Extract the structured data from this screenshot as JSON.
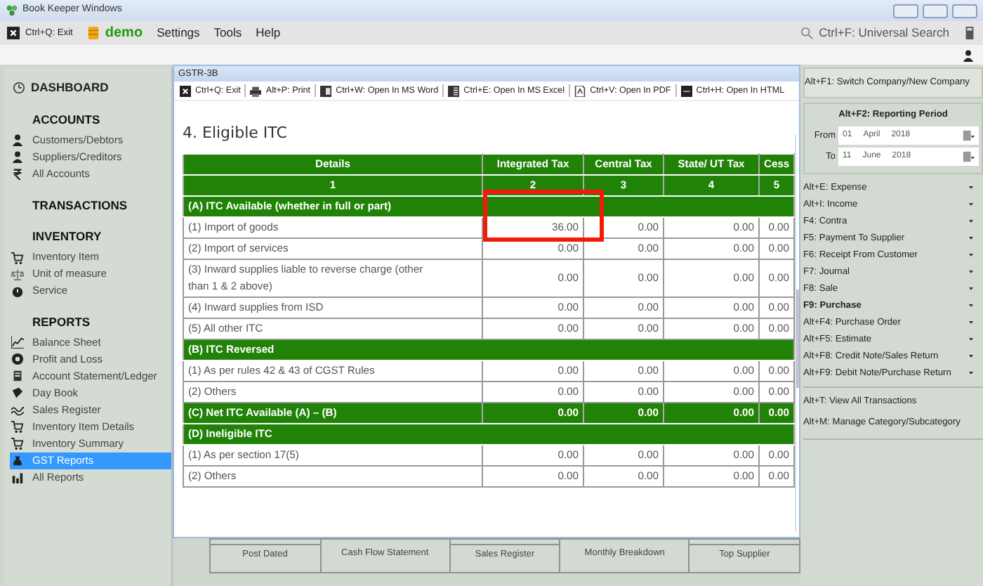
{
  "window": {
    "title": "Book Keeper Windows"
  },
  "menu_bar": {
    "exit": "Ctrl+Q: Exit",
    "company": "demo",
    "items": [
      "Settings",
      "Tools",
      "Help"
    ],
    "search": "Ctrl+F: Universal Search"
  },
  "sidebar": {
    "dashboard": "DASHBOARD",
    "sections": [
      {
        "title": "ACCOUNTS",
        "items": [
          {
            "label": "Customers/Debtors",
            "selected": false
          },
          {
            "label": "Suppliers/Creditors",
            "selected": false
          },
          {
            "label": "All Accounts",
            "selected": false
          }
        ]
      },
      {
        "title": "TRANSACTIONS"
      },
      {
        "title": "INVENTORY",
        "items": [
          {
            "label": "Inventory Item",
            "selected": false
          },
          {
            "label": "Unit of measure",
            "selected": false
          },
          {
            "label": "Service",
            "selected": false
          }
        ]
      },
      {
        "title": "REPORTS",
        "items": [
          {
            "label": "Balance Sheet",
            "selected": false
          },
          {
            "label": "Profit and Loss",
            "selected": false
          },
          {
            "label": "Account Statement/Ledger",
            "selected": false
          },
          {
            "label": "Day Book",
            "selected": false
          },
          {
            "label": "Sales Register",
            "selected": false
          },
          {
            "label": "Inventory Item Details",
            "selected": false
          },
          {
            "label": "Inventory Summary",
            "selected": false
          },
          {
            "label": "GST Reports",
            "selected": true
          },
          {
            "label": "All Reports",
            "selected": false
          }
        ]
      }
    ]
  },
  "dialog": {
    "title": "GSTR-3B",
    "toolbar": [
      {
        "kind": "exit",
        "label": "Ctrl+Q: Exit"
      },
      {
        "kind": "print",
        "label": "Alt+P: Print"
      },
      {
        "kind": "word",
        "label": "Ctrl+W: Open In MS Word"
      },
      {
        "kind": "excel",
        "label": "Ctrl+E: Open In MS Excel"
      },
      {
        "kind": "pdf",
        "label": "Ctrl+V: Open In PDF"
      },
      {
        "kind": "html",
        "label": "Ctrl+H: Open In HTML"
      }
    ],
    "heading": "4. Eligible ITC",
    "table": {
      "columns": [
        "Details",
        "Integrated Tax",
        "Central Tax",
        "State/ UT Tax",
        "Cess"
      ],
      "column_numbers": [
        "1",
        "2",
        "3",
        "4",
        "5"
      ],
      "rows": [
        {
          "kind": "section",
          "label": "(A) ITC Available (whether in full or part)"
        },
        {
          "kind": "data",
          "label": "(1) Import of goods",
          "values": [
            "36.00",
            "0.00",
            "0.00",
            "0.00"
          ],
          "highlighted": true
        },
        {
          "kind": "data",
          "label": "(2) Import of services",
          "values": [
            "0.00",
            "0.00",
            "0.00",
            "0.00"
          ],
          "highlighted": false
        },
        {
          "kind": "data",
          "label": "(3) Inward supplies liable to reverse charge (other than 1 & 2 above)",
          "values": [
            "0.00",
            "0.00",
            "0.00",
            "0.00"
          ],
          "highlighted": false
        },
        {
          "kind": "data",
          "label": "(4) Inward supplies from ISD",
          "values": [
            "0.00",
            "0.00",
            "0.00",
            "0.00"
          ],
          "highlighted": false
        },
        {
          "kind": "data",
          "label": "(5) All other ITC",
          "values": [
            "0.00",
            "0.00",
            "0.00",
            "0.00"
          ],
          "highlighted": false
        },
        {
          "kind": "section",
          "label": "(B) ITC Reversed"
        },
        {
          "kind": "data",
          "label": "(1) As per rules 42 & 43 of CGST Rules",
          "values": [
            "0.00",
            "0.00",
            "0.00",
            "0.00"
          ],
          "highlighted": false
        },
        {
          "kind": "data",
          "label": "(2) Others",
          "values": [
            "0.00",
            "0.00",
            "0.00",
            "0.00"
          ],
          "highlighted": false
        },
        {
          "kind": "total",
          "label": "(C) Net ITC Available (A) – (B)",
          "values": [
            "0.00",
            "0.00",
            "0.00",
            "0.00"
          ]
        },
        {
          "kind": "section",
          "label": "(D) Ineligible ITC"
        },
        {
          "kind": "data",
          "label": "(1) As per section 17(5)",
          "values": [
            "0.00",
            "0.00",
            "0.00",
            "0.00"
          ],
          "highlighted": false
        },
        {
          "kind": "data",
          "label": "(2) Others",
          "values": [
            "0.00",
            "0.00",
            "0.00",
            "0.00"
          ],
          "highlighted": false
        }
      ]
    }
  },
  "report_buttons": [
    {
      "label": "Post Dated",
      "tall": false
    },
    {
      "label": "Cash Flow Statement",
      "tall": true
    },
    {
      "label": "Sales Register",
      "tall": false
    },
    {
      "label": "Monthly Breakdown",
      "tall": true
    },
    {
      "label": "Top Supplier",
      "tall": false
    }
  ],
  "right_panel": {
    "switch_company": "Alt+F1: Switch Company/New Company",
    "reporting_period": {
      "title": "Alt+F2: Reporting Period",
      "dates": [
        {
          "label": "From",
          "day": "01",
          "month": "April",
          "year": "2018"
        },
        {
          "label": "To",
          "day": "11",
          "month": "June",
          "year": "2018"
        }
      ]
    },
    "actions": [
      {
        "label": "Alt+E: Expense",
        "bold": false
      },
      {
        "label": "Alt+I: Income",
        "bold": false
      },
      {
        "label": "F4: Contra",
        "bold": false
      },
      {
        "label": "F5: Payment To Supplier",
        "bold": false
      },
      {
        "label": "F6: Receipt From Customer",
        "bold": false
      },
      {
        "label": "F7: Journal",
        "bold": false
      },
      {
        "label": "F8: Sale",
        "bold": false
      },
      {
        "label": "F9: Purchase",
        "bold": true
      },
      {
        "label": "Alt+F4: Purchase Order",
        "bold": false
      },
      {
        "label": "Alt+F5: Estimate",
        "bold": false
      },
      {
        "label": "Alt+F8: Credit Note/Sales Return",
        "bold": false
      },
      {
        "label": "Alt+F9: Debit Note/Purchase Return",
        "bold": false
      }
    ],
    "links": [
      "Alt+T: View All Transactions",
      "Alt+M: Manage Category/Subcategory"
    ]
  }
}
